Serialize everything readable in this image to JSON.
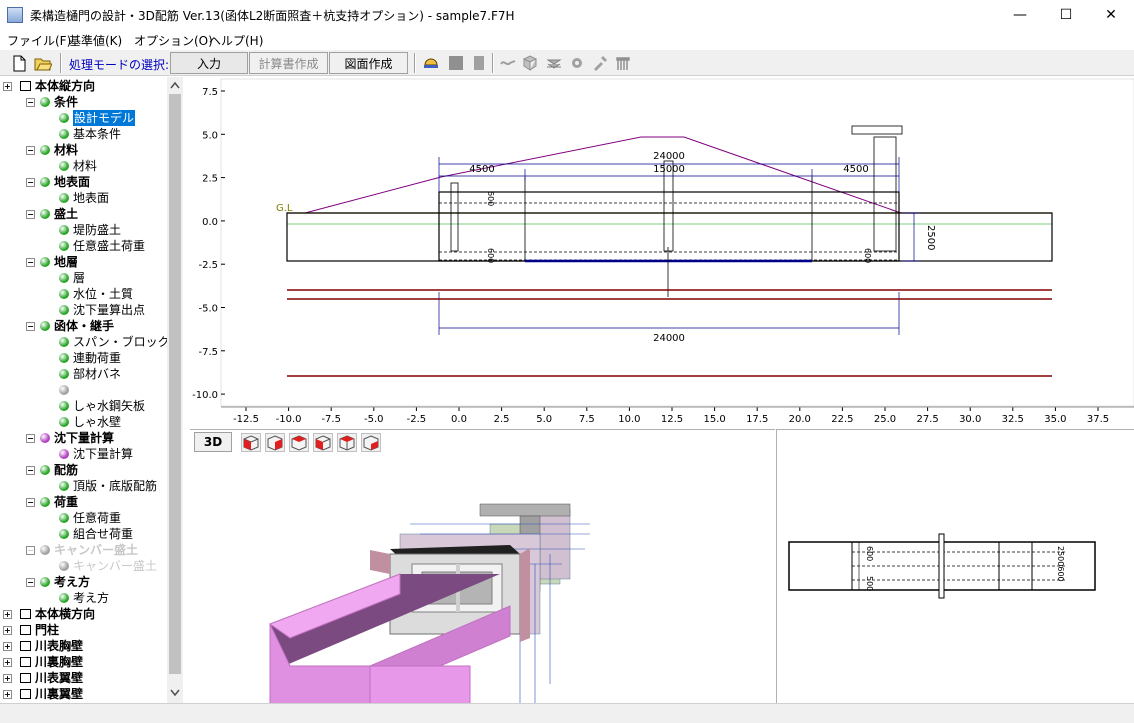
{
  "window": {
    "title": "柔構造樋門の設計・3D配筋 Ver.13(函体L2断面照査＋杭支持オプション) - sample7.F7H",
    "minimize": "—",
    "maximize": "☐",
    "close": "✕"
  },
  "menu": [
    {
      "label": "ファイル(F)"
    },
    {
      "label": "基準値(K)"
    },
    {
      "label": "オプション(O)"
    },
    {
      "label": "ヘルプ(H)"
    }
  ],
  "toolbar": {
    "mode_label": "処理モードの選択:",
    "input_button": "入力",
    "report_button": "計算書作成",
    "drawing_button": "図面作成"
  },
  "tree": [
    {
      "label": "本体縦方向",
      "level": 0,
      "bold": true
    },
    {
      "label": "条件",
      "level": 1,
      "bold": true,
      "color": "green"
    },
    {
      "label": "設計モデル",
      "level": 2,
      "color": "green",
      "selected": true
    },
    {
      "label": "基本条件",
      "level": 2,
      "color": "green"
    },
    {
      "label": "材料",
      "level": 1,
      "bold": true,
      "color": "green"
    },
    {
      "label": "材料",
      "level": 2,
      "color": "green"
    },
    {
      "label": "地表面",
      "level": 1,
      "bold": true,
      "color": "green"
    },
    {
      "label": "地表面",
      "level": 2,
      "color": "green"
    },
    {
      "label": "盛土",
      "level": 1,
      "bold": true,
      "color": "green"
    },
    {
      "label": "堤防盛土",
      "level": 2,
      "color": "green"
    },
    {
      "label": "任意盛土荷重",
      "level": 2,
      "color": "green"
    },
    {
      "label": "地層",
      "level": 1,
      "bold": true,
      "color": "green"
    },
    {
      "label": "層",
      "level": 2,
      "color": "green"
    },
    {
      "label": "水位・土質",
      "level": 2,
      "color": "green"
    },
    {
      "label": "沈下量算出点",
      "level": 2,
      "color": "green"
    },
    {
      "label": "函体・継手",
      "level": 1,
      "bold": true,
      "color": "green"
    },
    {
      "label": "スパン・ブロック",
      "level": 2,
      "color": "green"
    },
    {
      "label": "連動荷重",
      "level": 2,
      "color": "green"
    },
    {
      "label": "部材バネ",
      "level": 2,
      "color": "green"
    },
    {
      "label": "",
      "level": 2,
      "color": "gray"
    },
    {
      "label": "しゃ水鋼矢板",
      "level": 2,
      "color": "green"
    },
    {
      "label": "しゃ水壁",
      "level": 2,
      "color": "green"
    },
    {
      "label": "沈下量計算",
      "level": 1,
      "bold": true,
      "color": "purple"
    },
    {
      "label": "沈下量計算",
      "level": 2,
      "color": "purple"
    },
    {
      "label": "配筋",
      "level": 1,
      "bold": true,
      "color": "green"
    },
    {
      "label": "頂版・底版配筋",
      "level": 2,
      "color": "green"
    },
    {
      "label": "荷重",
      "level": 1,
      "bold": true,
      "color": "green"
    },
    {
      "label": "任意荷重",
      "level": 2,
      "color": "green"
    },
    {
      "label": "組合せ荷重",
      "level": 2,
      "color": "green"
    },
    {
      "label": "キャンバー盛土",
      "level": 1,
      "bold": true,
      "color": "gray",
      "disabled": true
    },
    {
      "label": "キャンバー盛土",
      "level": 2,
      "color": "gray",
      "disabled": true
    },
    {
      "label": "考え方",
      "level": 1,
      "bold": true,
      "color": "green"
    },
    {
      "label": "考え方",
      "level": 2,
      "color": "green"
    },
    {
      "label": "本体横方向",
      "level": 0,
      "bold": true
    },
    {
      "label": "門柱",
      "level": 0,
      "bold": true
    },
    {
      "label": "川表胸壁",
      "level": 0,
      "bold": true
    },
    {
      "label": "川裏胸壁",
      "level": 0,
      "bold": true
    },
    {
      "label": "川表翼壁",
      "level": 0,
      "bold": true
    },
    {
      "label": "川裏翼壁",
      "level": 0,
      "bold": true
    }
  ],
  "view_top": {
    "y_ticks": [
      "7.5",
      "5.0",
      "2.5",
      "0.0",
      "-2.5",
      "-5.0",
      "-7.5",
      "-10.0"
    ],
    "x_ticks": [
      "-12.5",
      "-10.0",
      "-7.5",
      "-5.0",
      "-2.5",
      "0.0",
      "2.5",
      "5.0",
      "7.5",
      "10.0",
      "12.5",
      "15.0",
      "17.5",
      "20.0",
      "22.5",
      "25.0",
      "27.5",
      "30.0",
      "32.5",
      "35.0",
      "37.5"
    ],
    "gl_label": "G.L",
    "dim_top_total": "24000",
    "dim_left": "4500",
    "dim_center": "15000",
    "dim_right": "4500",
    "dim_height": "2500",
    "dim_bottom_total": "24000",
    "haunch_label": "600"
  },
  "view_3d": {
    "button": "3D"
  },
  "view_plan": {
    "label_a": "600",
    "label_b": "500",
    "label_c": "2500600"
  },
  "colors": {
    "embankment": "#800080",
    "ground_line": "#808000",
    "box": "#000000",
    "layer": "#800000",
    "dimension": "#00008b",
    "water": "#008000"
  }
}
